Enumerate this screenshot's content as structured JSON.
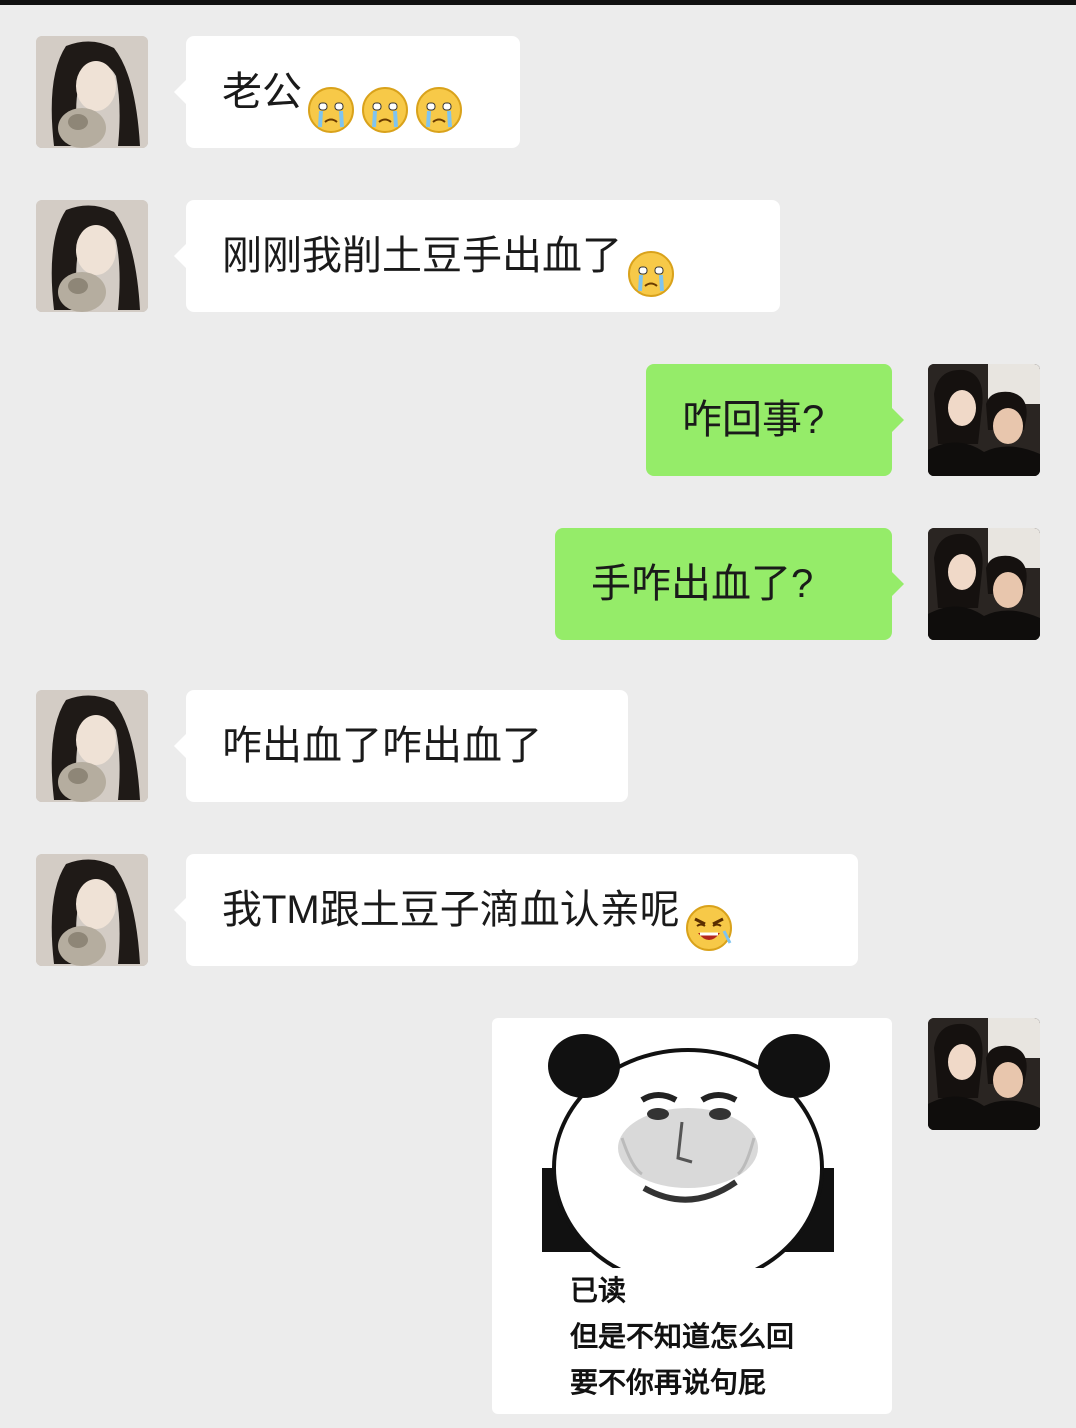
{
  "messages": [
    {
      "side": "left",
      "text": "老公",
      "emoji_count": 3,
      "emoji_icon": "crying-emoji"
    },
    {
      "side": "left",
      "text": "刚刚我削土豆手出血了",
      "emoji_count": 1,
      "emoji_icon": "crying-emoji"
    },
    {
      "side": "right",
      "text": "咋回事?"
    },
    {
      "side": "right",
      "text": "手咋出血了?"
    },
    {
      "side": "left",
      "text": "咋出血了咋出血了"
    },
    {
      "side": "left",
      "text": "我TM跟土豆子滴血认亲呢",
      "emoji_count": 1,
      "emoji_icon": "angry-laughing-emoji"
    }
  ],
  "sticker": {
    "icon": "panda-meme-sticker",
    "caption_lines": [
      "已读",
      "但是不知道怎么回",
      "要不你再说句屁"
    ]
  },
  "colors": {
    "background": "#ececec",
    "incoming_bubble": "#ffffff",
    "outgoing_bubble": "#95ec69",
    "text": "#1a1a1a"
  },
  "avatars": {
    "incoming": "girl-with-cat-avatar",
    "outgoing": "couple-photo-avatar"
  }
}
